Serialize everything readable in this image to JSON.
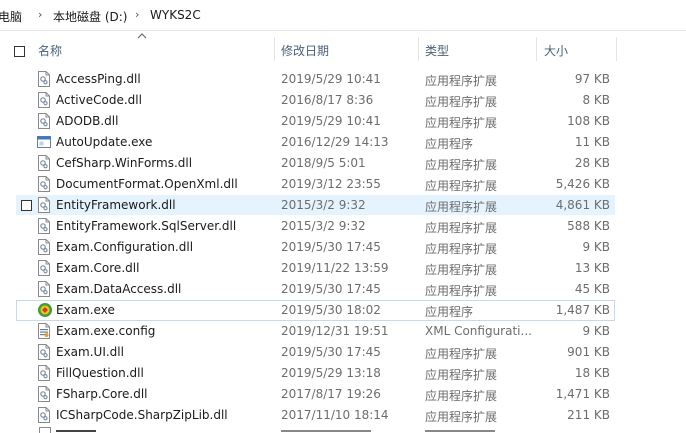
{
  "breadcrumb": {
    "items": [
      "电脑",
      "本地磁盘 (D:)",
      "WYKS2C"
    ],
    "separator": "›"
  },
  "columns": {
    "name": "名称",
    "date": "修改日期",
    "type": "类型",
    "size": "大小"
  },
  "icons": {
    "dll": "dll-file-icon",
    "exe": "exe-window-icon",
    "app": "app-logo-icon",
    "config": "config-file-icon"
  },
  "files": [
    {
      "name": "AccessPing.dll",
      "date": "2019/5/29 10:41",
      "type": "应用程序扩展",
      "size": "97 KB",
      "icon": "dll"
    },
    {
      "name": "ActiveCode.dll",
      "date": "2016/8/17 8:36",
      "type": "应用程序扩展",
      "size": "8 KB",
      "icon": "dll"
    },
    {
      "name": "ADODB.dll",
      "date": "2019/5/29 10:41",
      "type": "应用程序扩展",
      "size": "108 KB",
      "icon": "dll"
    },
    {
      "name": "AutoUpdate.exe",
      "date": "2016/12/29 14:13",
      "type": "应用程序",
      "size": "11 KB",
      "icon": "exe"
    },
    {
      "name": "CefSharp.WinForms.dll",
      "date": "2018/9/5 5:01",
      "type": "应用程序扩展",
      "size": "28 KB",
      "icon": "dll"
    },
    {
      "name": "DocumentFormat.OpenXml.dll",
      "date": "2019/3/12 23:55",
      "type": "应用程序扩展",
      "size": "5,426 KB",
      "icon": "dll"
    },
    {
      "name": "EntityFramework.dll",
      "date": "2015/3/2 9:32",
      "type": "应用程序扩展",
      "size": "4,861 KB",
      "icon": "dll"
    },
    {
      "name": "EntityFramework.SqlServer.dll",
      "date": "2015/3/2 9:32",
      "type": "应用程序扩展",
      "size": "588 KB",
      "icon": "dll"
    },
    {
      "name": "Exam.Configuration.dll",
      "date": "2019/5/30 17:45",
      "type": "应用程序扩展",
      "size": "9 KB",
      "icon": "dll"
    },
    {
      "name": "Exam.Core.dll",
      "date": "2019/11/22 13:59",
      "type": "应用程序扩展",
      "size": "13 KB",
      "icon": "dll"
    },
    {
      "name": "Exam.DataAccess.dll",
      "date": "2019/5/30 17:45",
      "type": "应用程序扩展",
      "size": "45 KB",
      "icon": "dll"
    },
    {
      "name": "Exam.exe",
      "date": "2019/5/30 18:02",
      "type": "应用程序",
      "size": "1,487 KB",
      "icon": "app"
    },
    {
      "name": "Exam.exe.config",
      "date": "2019/12/31 19:51",
      "type": "XML Configurati...",
      "size": "9 KB",
      "icon": "config"
    },
    {
      "name": "Exam.UI.dll",
      "date": "2019/5/30 17:45",
      "type": "应用程序扩展",
      "size": "901 KB",
      "icon": "dll"
    },
    {
      "name": "FillQuestion.dll",
      "date": "2019/5/29 13:18",
      "type": "应用程序扩展",
      "size": "18 KB",
      "icon": "dll"
    },
    {
      "name": "FSharp.Core.dll",
      "date": "2017/8/17 19:26",
      "type": "应用程序扩展",
      "size": "1,471 KB",
      "icon": "dll"
    },
    {
      "name": "ICSharpCode.SharpZipLib.dll",
      "date": "2017/11/10 18:14",
      "type": "应用程序扩展",
      "size": "211 KB",
      "icon": "dll"
    }
  ],
  "hover_index": 6,
  "focus_index": 11
}
